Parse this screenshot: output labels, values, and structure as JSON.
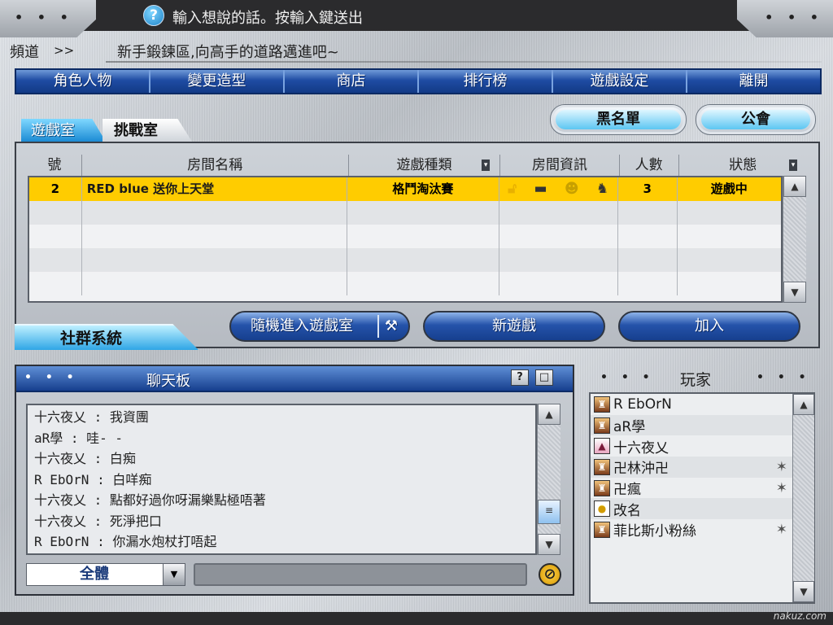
{
  "top": {
    "hint": "輸入想說的話。按輸入鍵送出",
    "dots_left": "• • •",
    "dots_right": "• • •",
    "help_glyph": "?"
  },
  "channel": {
    "label": "頻道",
    "arrow": ">>",
    "message": "新手鍛鍊區,向高手的道路邁進吧~"
  },
  "menu": {
    "items": [
      "角色人物",
      "變更造型",
      "商店",
      "排行榜",
      "遊戲設定",
      "離開"
    ]
  },
  "buttons": {
    "blacklist": "黑名單",
    "guild": "公會",
    "random_join": "隨機進入遊戲室",
    "new_game": "新遊戲",
    "join": "加入"
  },
  "room_tabs": {
    "game_room": "遊戲室",
    "challenge_room": "挑戰室"
  },
  "room_list": {
    "columns": [
      "號",
      "房間名稱",
      "遊戲種類",
      "房間資訊",
      "人數",
      "狀態"
    ],
    "rows": [
      {
        "number": "2",
        "name": "RED blue 送你上天堂",
        "type": "格鬥淘汰賽",
        "count": "3",
        "status": "遊戲中"
      },
      {
        "number": "",
        "name": "",
        "type": "",
        "count": "",
        "status": ""
      },
      {
        "number": "",
        "name": "",
        "type": "",
        "count": "",
        "status": ""
      },
      {
        "number": "",
        "name": "",
        "type": "",
        "count": "",
        "status": ""
      },
      {
        "number": "",
        "name": "",
        "type": "",
        "count": "",
        "status": ""
      }
    ],
    "info_icons": [
      "lock-icon",
      "gun-icon",
      "smiley-icon",
      "character-icon"
    ]
  },
  "social_tab": "社群系統",
  "chat": {
    "title": "聊天板",
    "lines": [
      "十六夜乂 : 我資團",
      "aR學 : 哇- -",
      "十六夜乂 : 白痴",
      "R EbOrN : 白咩痴",
      "十六夜乂 : 點都好過你呀漏樂點極唔著",
      "十六夜乂 : 死淨把口",
      "R EbOrN : 你漏水炮杖打唔起"
    ],
    "target": "全體",
    "input_value": ""
  },
  "players": {
    "title": "玩家",
    "list": [
      {
        "name": "R EbOrN",
        "avatar": "warrior",
        "badge": false
      },
      {
        "name": "aR學",
        "avatar": "warrior",
        "badge": false
      },
      {
        "name": "十六夜乂",
        "avatar": "witch",
        "badge": false
      },
      {
        "name": "卍林沖卍",
        "avatar": "warrior",
        "badge": true
      },
      {
        "name": "卍瘋",
        "avatar": "warrior",
        "badge": true
      },
      {
        "name": "改名",
        "avatar": "egg",
        "badge": false
      },
      {
        "name": "菲比斯小粉絲",
        "avatar": "warrior",
        "badge": true
      }
    ]
  },
  "watermark": "nakuz.com",
  "colors": {
    "menu_blue": "#1f4ca3",
    "selected_row": "#ffcc00",
    "tab_cyan": "#1c8bd4"
  }
}
